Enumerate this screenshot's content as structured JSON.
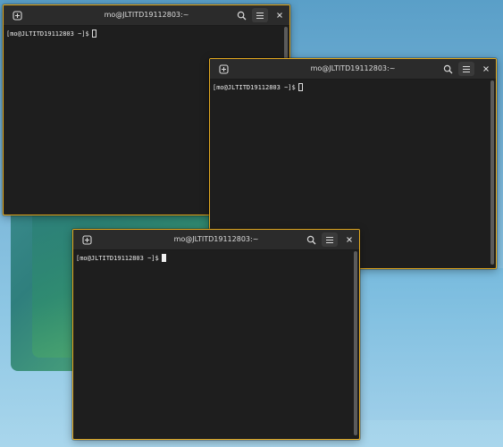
{
  "desktop": {
    "background_color": "#7db8da"
  },
  "windows": [
    {
      "title": "mo@JLTITD19112803:~",
      "prompt": "[mo@JLTITD19112803 ~]$",
      "border_color": "#e3a91f"
    },
    {
      "title": "mo@JLTITD19112803:~",
      "prompt": "[mo@JLTITD19112803 ~]$",
      "border_color": "#e3a91f"
    },
    {
      "title": "mo@JLTITD19112803:~",
      "prompt": "[mo@JLTITD19112803 ~]$",
      "border_color": "#e3a91f"
    }
  ],
  "icons": {
    "new_tab": "new-tab-icon",
    "search": "search-icon",
    "menu": "hamburger-menu-icon",
    "close": "close-icon"
  }
}
